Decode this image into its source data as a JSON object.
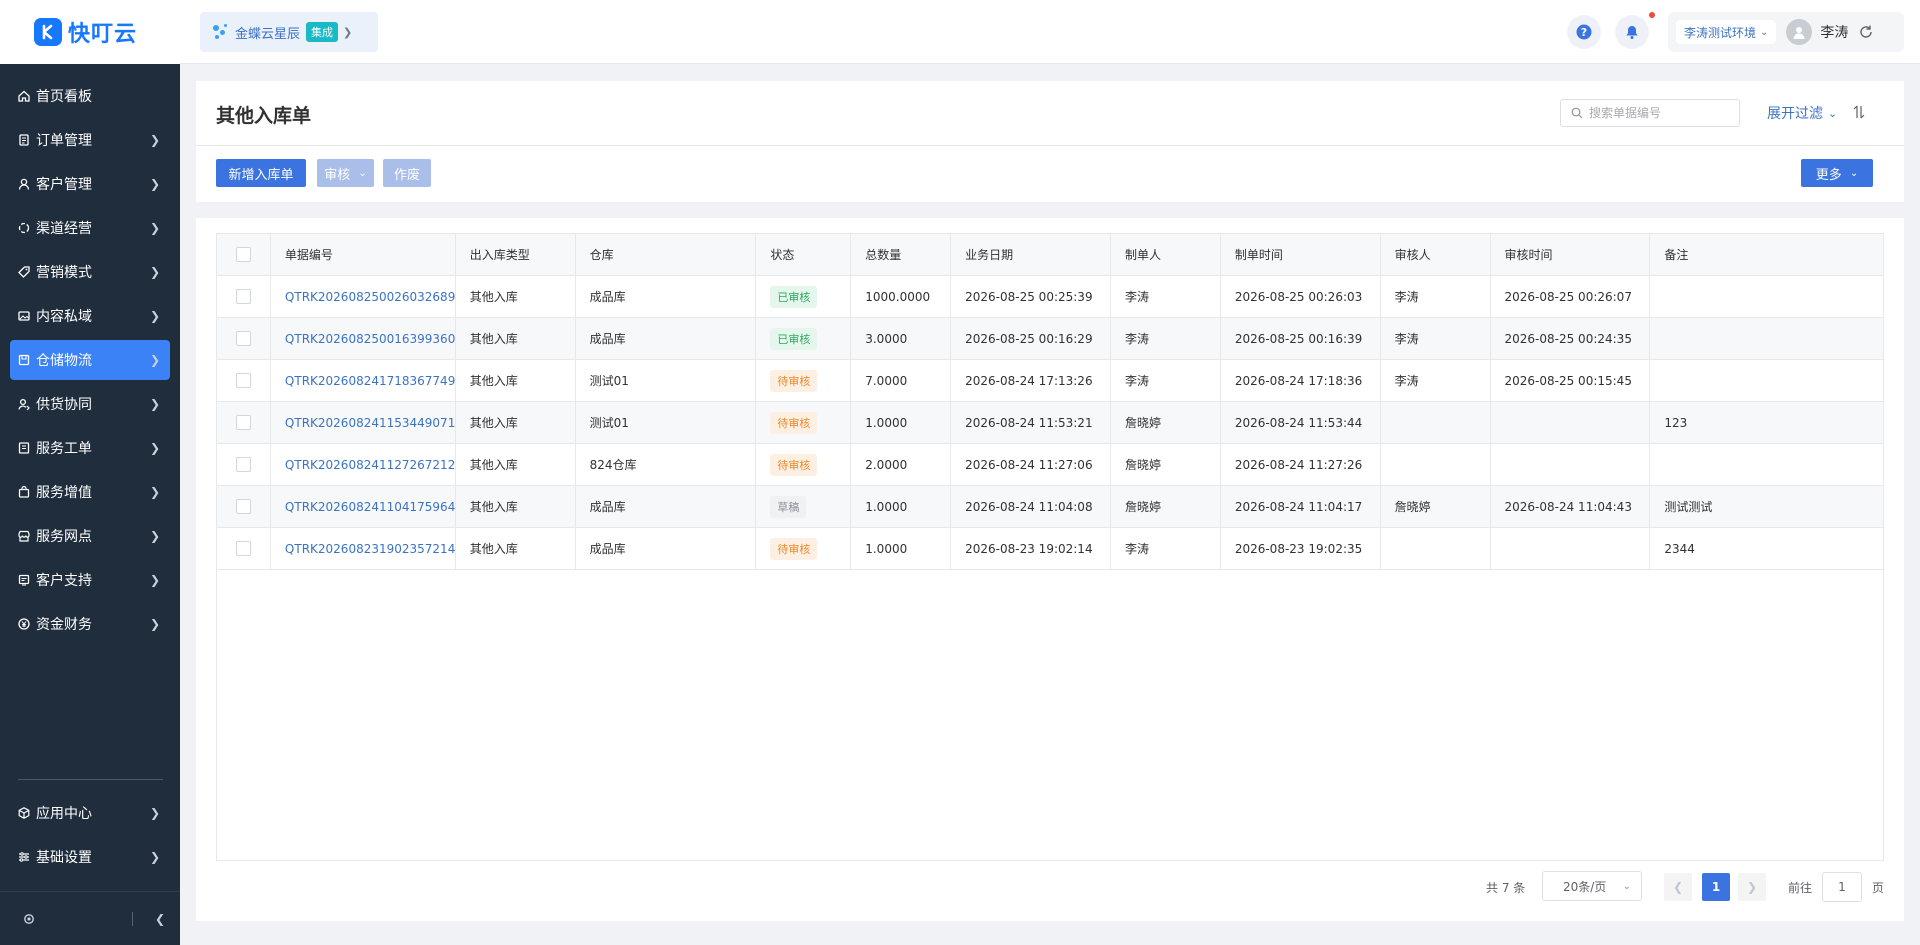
{
  "brand": {
    "name": "快叮云"
  },
  "sidebar": {
    "items": [
      {
        "label": "首页看板",
        "icon": "home-icon",
        "chevron": false
      },
      {
        "label": "订单管理",
        "icon": "order-icon",
        "chevron": true
      },
      {
        "label": "客户管理",
        "icon": "user-icon",
        "chevron": true
      },
      {
        "label": "渠道经营",
        "icon": "channel-icon",
        "chevron": true
      },
      {
        "label": "营销模式",
        "icon": "tag-icon",
        "chevron": true
      },
      {
        "label": "内容私域",
        "icon": "image-icon",
        "chevron": true
      },
      {
        "label": "仓储物流",
        "icon": "warehouse-icon",
        "chevron": true,
        "active": true
      },
      {
        "label": "供货协同",
        "icon": "supply-icon",
        "chevron": true
      },
      {
        "label": "服务工单",
        "icon": "workorder-icon",
        "chevron": true
      },
      {
        "label": "服务增值",
        "icon": "bag-icon",
        "chevron": true
      },
      {
        "label": "服务网点",
        "icon": "store-icon",
        "chevron": true
      },
      {
        "label": "客户支持",
        "icon": "support-icon",
        "chevron": true
      },
      {
        "label": "资金财务",
        "icon": "yen-icon",
        "chevron": true
      }
    ],
    "bottom_items": [
      {
        "label": "应用中心",
        "icon": "cube-icon"
      },
      {
        "label": "基础设置",
        "icon": "settings-sliders-icon"
      }
    ]
  },
  "header": {
    "integration": {
      "name": "金蝶云星辰",
      "tag": "集成"
    },
    "environment": "李涛测试环境",
    "user_name": "李涛"
  },
  "page": {
    "title": "其他入库单",
    "search_placeholder": "搜索单据编号",
    "filter_label": "展开过滤",
    "buttons": {
      "add": "新增入库单",
      "audit": "审核",
      "void": "作废",
      "more": "更多"
    }
  },
  "table": {
    "columns": [
      "单据编号",
      "出入库类型",
      "仓库",
      "状态",
      "总数量",
      "业务日期",
      "制单人",
      "制单时间",
      "审核人",
      "审核时间",
      "备注"
    ],
    "rows": [
      {
        "doc_no": "QTRK202608250026032689",
        "type": "其他入库",
        "warehouse": "成品库",
        "status": "已审核",
        "status_kind": "done",
        "qty": "1000.0000",
        "biz_date": "2026-08-25 00:25:39",
        "creator": "李涛",
        "created_at": "2026-08-25 00:26:03",
        "auditor": "李涛",
        "audited_at": "2026-08-25 00:26:07",
        "remark": ""
      },
      {
        "doc_no": "QTRK202608250016399360",
        "type": "其他入库",
        "warehouse": "成品库",
        "status": "已审核",
        "status_kind": "done",
        "qty": "3.0000",
        "biz_date": "2026-08-25 00:16:29",
        "creator": "李涛",
        "created_at": "2026-08-25 00:16:39",
        "auditor": "李涛",
        "audited_at": "2026-08-25 00:24:35",
        "remark": ""
      },
      {
        "doc_no": "QTRK202608241718367749",
        "type": "其他入库",
        "warehouse": "测试01",
        "status": "待审核",
        "status_kind": "pending",
        "qty": "7.0000",
        "biz_date": "2026-08-24 17:13:26",
        "creator": "李涛",
        "created_at": "2026-08-24 17:18:36",
        "auditor": "李涛",
        "audited_at": "2026-08-25 00:15:45",
        "remark": ""
      },
      {
        "doc_no": "QTRK202608241153449071",
        "type": "其他入库",
        "warehouse": "测试01",
        "status": "待审核",
        "status_kind": "pending",
        "qty": "1.0000",
        "biz_date": "2026-08-24 11:53:21",
        "creator": "詹晓婷",
        "created_at": "2026-08-24 11:53:44",
        "auditor": "",
        "audited_at": "",
        "remark": "123"
      },
      {
        "doc_no": "QTRK202608241127267212",
        "type": "其他入库",
        "warehouse": "824仓库",
        "status": "待审核",
        "status_kind": "pending",
        "qty": "2.0000",
        "biz_date": "2026-08-24 11:27:06",
        "creator": "詹晓婷",
        "created_at": "2026-08-24 11:27:26",
        "auditor": "",
        "audited_at": "",
        "remark": ""
      },
      {
        "doc_no": "QTRK202608241104175964",
        "type": "其他入库",
        "warehouse": "成品库",
        "status": "草稿",
        "status_kind": "draft",
        "qty": "1.0000",
        "biz_date": "2026-08-24 11:04:08",
        "creator": "詹晓婷",
        "created_at": "2026-08-24 11:04:17",
        "auditor": "詹晓婷",
        "audited_at": "2026-08-24 11:04:43",
        "remark": "测试测试"
      },
      {
        "doc_no": "QTRK202608231902357214",
        "type": "其他入库",
        "warehouse": "成品库",
        "status": "待审核",
        "status_kind": "pending",
        "qty": "1.0000",
        "biz_date": "2026-08-23 19:02:14",
        "creator": "李涛",
        "created_at": "2026-08-23 19:02:35",
        "auditor": "",
        "audited_at": "",
        "remark": "2344"
      }
    ]
  },
  "pagination": {
    "total": "共 7 条",
    "page_size": "20条/页",
    "current_page": "1",
    "goto_label": "前往",
    "goto_value": "1",
    "page_suffix": "页"
  },
  "colors": {
    "accent": "#3b73e0",
    "sidebar_bg": "#1f2d3d",
    "link": "#3b73c4"
  }
}
